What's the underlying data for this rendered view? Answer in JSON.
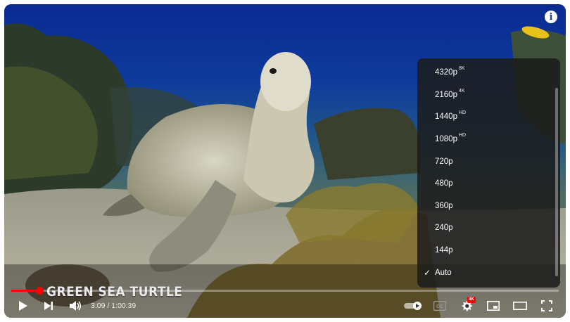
{
  "video": {
    "title_overlay": "GREEN SEA TURTLE"
  },
  "time": {
    "current": "3:09",
    "separator": " / ",
    "duration": "1:00:39"
  },
  "progress": {
    "played_fraction": 0.052
  },
  "quality_menu": {
    "items": [
      {
        "label": "4320p",
        "badge": "8K",
        "selected": false
      },
      {
        "label": "2160p",
        "badge": "4K",
        "selected": false
      },
      {
        "label": "1440p",
        "badge": "HD",
        "selected": false
      },
      {
        "label": "1080p",
        "badge": "HD",
        "selected": false
      },
      {
        "label": "720p",
        "badge": "",
        "selected": false
      },
      {
        "label": "480p",
        "badge": "",
        "selected": false
      },
      {
        "label": "360p",
        "badge": "",
        "selected": false
      },
      {
        "label": "240p",
        "badge": "",
        "selected": false
      },
      {
        "label": "144p",
        "badge": "",
        "selected": false
      },
      {
        "label": "Auto",
        "badge": "",
        "selected": true
      }
    ],
    "check_glyph": "✓"
  },
  "settings_badge": "4K",
  "colors": {
    "accent": "#ff0000",
    "menu_bg": "#1c1c1c"
  },
  "icons": {
    "info": "info-icon",
    "play": "play-icon",
    "next": "next-icon",
    "volume": "volume-icon",
    "autoplay": "autoplay-toggle-icon",
    "captions": "captions-icon",
    "settings": "gear-icon",
    "miniplayer": "miniplayer-icon",
    "theater": "theater-mode-icon",
    "fullscreen": "fullscreen-icon"
  }
}
